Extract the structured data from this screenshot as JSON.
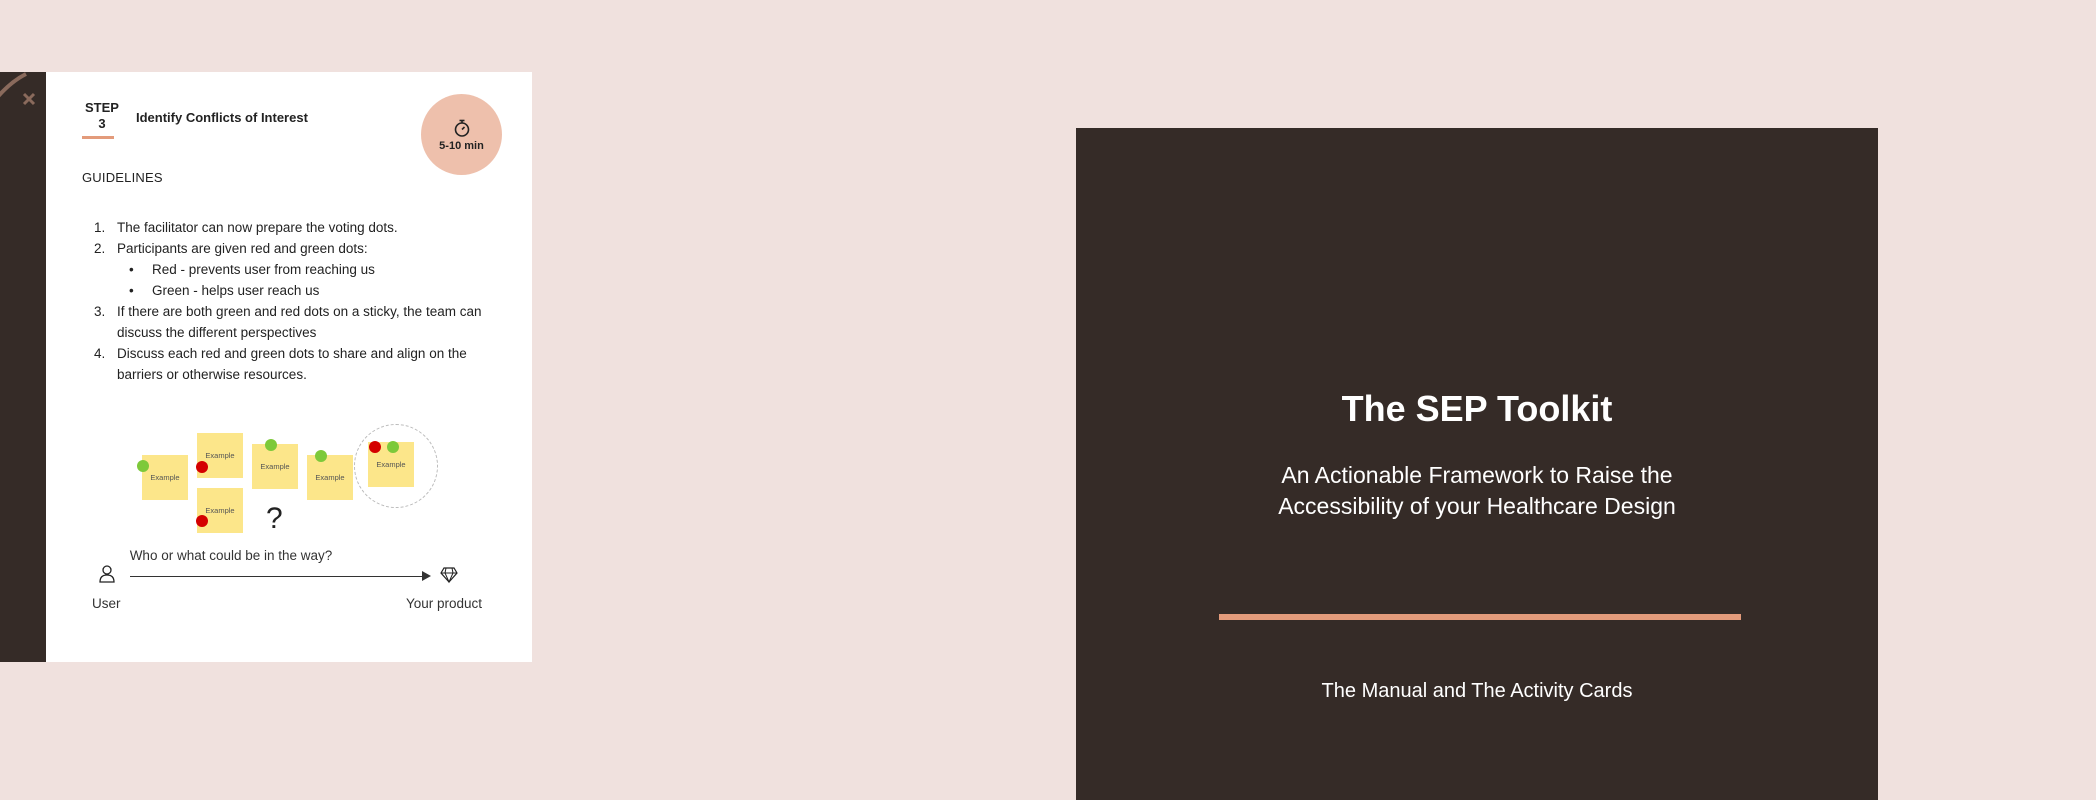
{
  "activity_card": {
    "step_label": "STEP",
    "step_number": "3",
    "title": "Identify Conflicts of Interest",
    "duration": "5-10 min",
    "guidelines_heading": "GUIDELINES",
    "items": [
      {
        "num": "1.",
        "text": "The facilitator can now prepare the voting dots."
      },
      {
        "num": "2.",
        "text": "Participants are given red and green dots:"
      },
      {
        "num": "3.",
        "text": "If there are both green and red dots on a sticky, the team can discuss the different perspectives"
      },
      {
        "num": "4.",
        "text": "Discuss each red and green dots to share and align on the barriers or otherwise resources."
      }
    ],
    "subitems": [
      {
        "bullet": "•",
        "text": "Red - prevents user from reaching us"
      },
      {
        "bullet": "•",
        "text": "Green - helps user reach us"
      }
    ],
    "sticky_label": "Example",
    "question_mark": "?",
    "question": "Who or what could be in the way?",
    "user_label": "User",
    "product_label": "Your product"
  },
  "cover": {
    "title": "The SEP Toolkit",
    "subtitle": "An Actionable Framework to Raise the Accessibility of your Healthcare Design",
    "footer": "The Manual and The Activity Cards"
  },
  "colors": {
    "background": "#f0e1de",
    "dark": "#352b27",
    "accent": "#e39b7b",
    "timer": "#eec0ac",
    "sticky": "#fce68a",
    "green_dot": "#7dc93a",
    "red_dot": "#d40000"
  },
  "icons": [
    "stopwatch-icon",
    "user-icon",
    "diamond-icon",
    "cross-decoration-icon"
  ]
}
